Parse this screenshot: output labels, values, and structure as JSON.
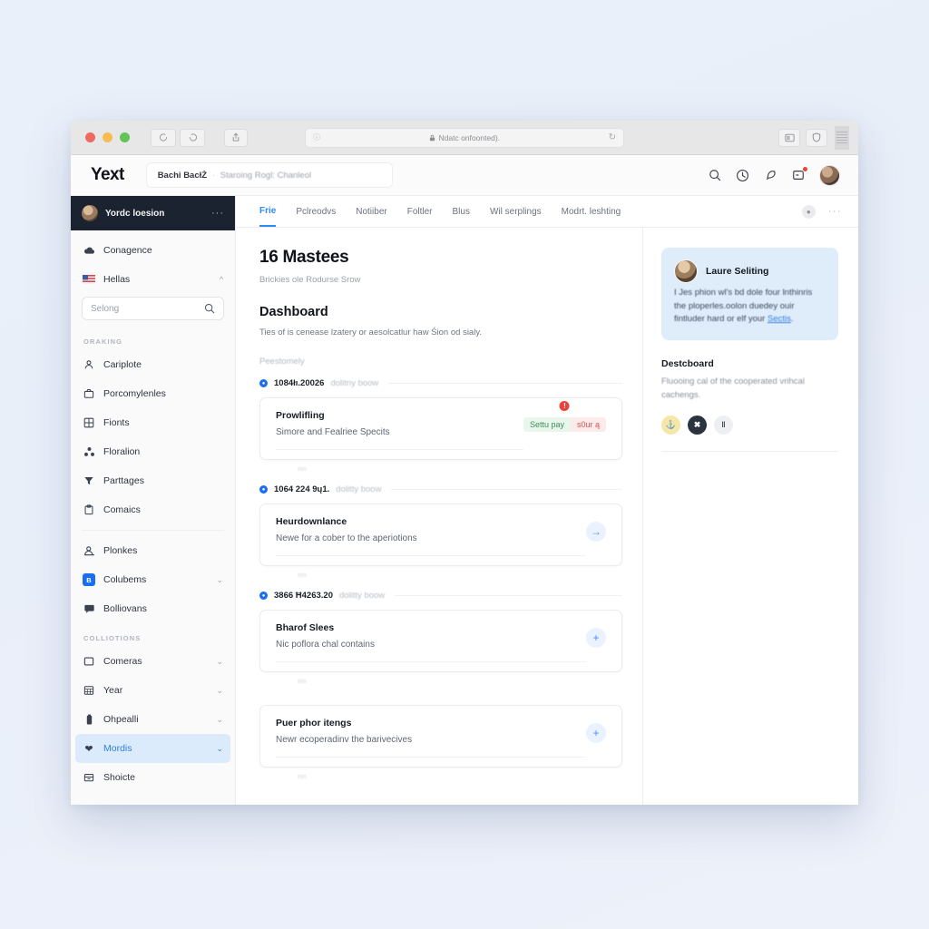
{
  "browser": {
    "traffic_lights": [
      "close",
      "minimize",
      "zoom"
    ],
    "url_text": "Ndatc onfoonted).",
    "lock_icon": "lock-icon",
    "reload_icon": "reload-icon",
    "back_icon": "back-icon",
    "forward_icon": "forward-icon",
    "share_icon": "share-icon",
    "tabs_icon": "tabs-overview-icon",
    "shield_icon": "shield-icon"
  },
  "header": {
    "brand": "Yext",
    "breadcrumb_primary": "Bachi BacłŻ",
    "breadcrumb_separator": "·",
    "breadcrumb_secondary": "Staroing Rogl: Chanleol",
    "icons": [
      {
        "name": "search-icon"
      },
      {
        "name": "help-circle-icon"
      },
      {
        "name": "feather-icon"
      },
      {
        "name": "inbox-icon",
        "badge": true
      }
    ],
    "avatar": "user-avatar"
  },
  "sidebar": {
    "account": {
      "name": "Yordc loesion",
      "menu": "···"
    },
    "top_items": [
      {
        "label": "Conagence",
        "icon": "cloud-icon",
        "chevron": false
      },
      {
        "label": "Hellas",
        "icon": "flag-icon",
        "chevron": "up"
      }
    ],
    "search": {
      "placeholder": "Selong",
      "icon": "search-icon"
    },
    "sections": [
      {
        "title": "ORAKING",
        "items": [
          {
            "label": "Cariplote",
            "icon": "person-icon",
            "chevron": false
          },
          {
            "label": "Porcomylenles",
            "icon": "briefcase-icon",
            "chevron": false
          },
          {
            "label": "Fionts",
            "icon": "grid-icon",
            "chevron": false
          },
          {
            "label": "Floralion",
            "icon": "nodes-icon",
            "chevron": false
          },
          {
            "label": "Parttages",
            "icon": "funnel-icon",
            "chevron": false
          },
          {
            "label": "Comaics",
            "icon": "clipboard-icon",
            "chevron": false
          }
        ]
      },
      {
        "title": "",
        "items": [
          {
            "label": "Plonkes",
            "icon": "user-screen-icon",
            "chevron": false
          },
          {
            "label": "Colubems",
            "icon": "blue-square-icon",
            "chevron": "down"
          },
          {
            "label": "Bolliovans",
            "icon": "chat-icon",
            "chevron": false
          }
        ]
      },
      {
        "title": "COLLIOTIONS",
        "items": [
          {
            "label": "Comeras",
            "icon": "square-icon",
            "chevron": "down"
          },
          {
            "label": "Year",
            "icon": "calendar-grid-icon",
            "chevron": "down"
          },
          {
            "label": "Ohpealli",
            "icon": "battery-icon",
            "chevron": "down"
          },
          {
            "label": "Mordis",
            "icon": "heart-icon",
            "chevron": "down",
            "active": true
          },
          {
            "label": "Shoicte",
            "icon": "archive-icon",
            "chevron": false
          }
        ]
      }
    ]
  },
  "tabs": [
    {
      "label": "Frie",
      "selected": true
    },
    {
      "label": "Pclreodvs",
      "selected": false
    },
    {
      "label": "Notiiber",
      "selected": false
    },
    {
      "label": "Foltler",
      "selected": false
    },
    {
      "label": "Blus",
      "selected": false
    },
    {
      "label": "Wil serplings",
      "selected": false
    },
    {
      "label": "Modrt. leshting",
      "selected": false
    }
  ],
  "tabbar_right": {
    "avatar": "user-avatar-small",
    "more": "···"
  },
  "main": {
    "title": "16 Mastees",
    "subtitle": "Brickies ole Rodurse Srow",
    "section_title": "Dashboard",
    "section_desc": "Ties of is cenease lzatery or aesolcatlur haw Śion od sialy.",
    "list_label": "Peestomely",
    "groups": [
      {
        "id": "1084łı.20026",
        "meta": "dolitny boow",
        "card": {
          "title": "Prowlifling",
          "desc": "Simore and Fealriee Specits",
          "action": "status-pills",
          "alert": "!",
          "pill_green": "Settu pay",
          "pill_red": "s0ur ą"
        },
        "hint": "mn"
      },
      {
        "id": "1064 224 9ų1.",
        "meta": "dolitty boow",
        "card": {
          "title": "Heurdownlance",
          "desc": "Newe for a cober to the aperiotions",
          "action": "arrow-right",
          "arrow": "→"
        },
        "hint": "mn"
      },
      {
        "id": "3866 Ħ4263.20",
        "meta": "dolitty boow",
        "card": {
          "title": "Bharof Slees",
          "desc": "Nic poflora chal contains",
          "action": "plus",
          "arrow": "+"
        },
        "hint": "mn"
      },
      {
        "id": "",
        "meta": "",
        "card": {
          "title": "Puer phor itengs",
          "desc": "Newr ecoperadinv the barivecives",
          "action": "plus-alt",
          "arrow": "+"
        },
        "hint": "mn"
      }
    ]
  },
  "rail": {
    "note": {
      "author": "Laure Seliting",
      "body_1": "I Jes phion wl's bd dole four lnthinris the ploperles.oolon duedey ouir fintluder hard or elf your ",
      "link": "Sectis",
      "body_2": "."
    },
    "heading": "Destcboard",
    "paragraph": "Fluooing cal of the cooperated vrihcal cachengs.",
    "chips": [
      {
        "label": "⚓",
        "style": "yellow"
      },
      {
        "label": "✖",
        "style": "dark"
      },
      {
        "label": "‖",
        "style": "gray"
      }
    ]
  },
  "colors": {
    "accent": "#2f8af5",
    "sidebar_header": "#1b2230",
    "active_item_bg": "#dcebfb",
    "note_bg": "#dfecfa",
    "alert_red": "#e8443a",
    "success_green": "#3f8f59",
    "page_bg": "#e8eef8"
  }
}
